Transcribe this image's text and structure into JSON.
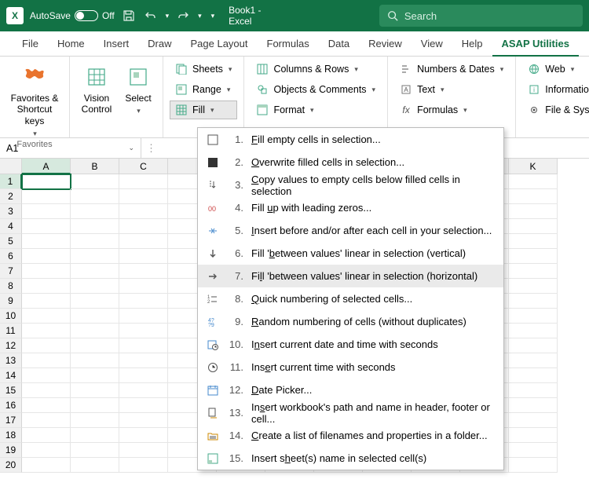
{
  "titlebar": {
    "autosave_label": "AutoSave",
    "autosave_state": "Off",
    "app_title": "Book1 - Excel"
  },
  "search": {
    "placeholder": "Search"
  },
  "menu": {
    "file": "File",
    "home": "Home",
    "insert": "Insert",
    "draw": "Draw",
    "page_layout": "Page Layout",
    "formulas": "Formulas",
    "data": "Data",
    "review": "Review",
    "view": "View",
    "help": "Help",
    "asap": "ASAP Utilities"
  },
  "ribbon": {
    "favorites_label": "Favorites & Shortcut keys",
    "favorites_group": "Favorites",
    "vision_label": "Vision Control",
    "select_label": "Select",
    "sheets": "Sheets",
    "range": "Range",
    "fill": "Fill",
    "columns_rows": "Columns & Rows",
    "objects_comments": "Objects & Comments",
    "format": "Format",
    "numbers_dates": "Numbers & Dates",
    "text": "Text",
    "formulas": "Formulas",
    "web": "Web",
    "information": "Information",
    "file_system": "File & System"
  },
  "namebox": {
    "value": "A1"
  },
  "cols": [
    "A",
    "B",
    "C",
    "",
    "",
    "",
    "",
    "",
    "",
    "",
    "K"
  ],
  "rows": 20,
  "menu_items": [
    {
      "num": "1.",
      "text": "Fill empty cells in selection...",
      "hk": "F",
      "icon": "square-empty"
    },
    {
      "num": "2.",
      "text": "Overwrite filled cells in selection...",
      "hk": "O",
      "icon": "square-filled"
    },
    {
      "num": "3.",
      "text": "Copy values to empty cells below filled cells in selection",
      "hk": "C",
      "icon": "list-down"
    },
    {
      "num": "4.",
      "text": "Fill up with leading zeros...",
      "hk": "u",
      "icon": "zeros"
    },
    {
      "num": "5.",
      "text": "Insert before and/or after each cell in your selection...",
      "hk": "I",
      "icon": "insert-ba"
    },
    {
      "num": "6.",
      "text": "Fill 'between values' linear in selection (vertical)",
      "hk": "b",
      "icon": "arrow-down"
    },
    {
      "num": "7.",
      "text": "Fill 'between values' linear in selection (horizontal)",
      "hk": "l",
      "icon": "arrow-right"
    },
    {
      "num": "8.",
      "text": "Quick numbering of selected cells...",
      "hk": "Q",
      "icon": "numbered"
    },
    {
      "num": "9.",
      "text": "Random numbering of cells (without duplicates)",
      "hk": "R",
      "icon": "random"
    },
    {
      "num": "10.",
      "text": "Insert current date and time with seconds",
      "hk": "n",
      "icon": "calendar-clock"
    },
    {
      "num": "11.",
      "text": "Insert current time with seconds",
      "hk": "e",
      "icon": "clock"
    },
    {
      "num": "12.",
      "text": "Date Picker...",
      "hk": "D",
      "icon": "calendar"
    },
    {
      "num": "13.",
      "text": "Insert workbook's path and name in header, footer or cell...",
      "hk": "s",
      "icon": "path"
    },
    {
      "num": "14.",
      "text": "Create a list of filenames and properties in a folder...",
      "hk": "C",
      "icon": "folder-list"
    },
    {
      "num": "15.",
      "text": "Insert sheet(s) name in selected cell(s)",
      "hk": "h",
      "icon": "sheet-name"
    }
  ],
  "hover_index": 6
}
